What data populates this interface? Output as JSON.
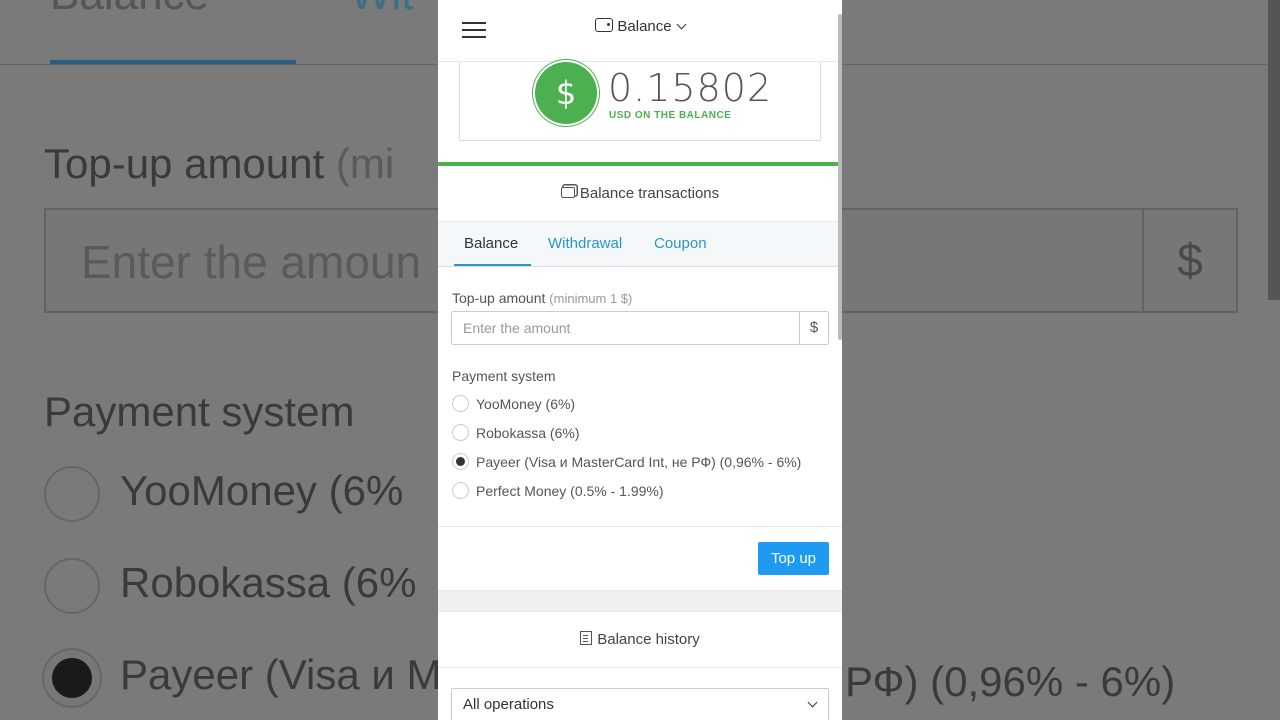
{
  "background": {
    "tab_balance": "Balance",
    "tab_withdrawal": "Wit",
    "topup_label": "Top-up amount",
    "topup_label_muted": "(mi",
    "amount_placeholder": "Enter the amoun",
    "currency_symbol": "$",
    "payment_label": "Payment system",
    "option_1": "YooMoney  (6%",
    "option_2": "Robokassa   (6%",
    "option_3": "Payeer (Visa и M",
    "option_3_tail": "РФ)  (0,96% - 6%)"
  },
  "header": {
    "title": "Balance",
    "wallet_icon": "wallet-icon",
    "menu_icon": "hamburger-icon"
  },
  "balance": {
    "amount": "0.15802",
    "unit_label": "USD ON THE BALANCE",
    "currency_symbol": "$",
    "accent_color": "#4caf50"
  },
  "transactions": {
    "title": "Balance transactions"
  },
  "tabs": [
    {
      "label": "Balance",
      "active": true
    },
    {
      "label": "Withdrawal",
      "active": false
    },
    {
      "label": "Coupon",
      "active": false
    }
  ],
  "topup_form": {
    "amount_label": "Top-up amount",
    "amount_hint": "(minimum 1 $)",
    "amount_placeholder": "Enter the amount",
    "amount_value": "",
    "currency_symbol": "$",
    "payment_label": "Payment system",
    "payment_options": [
      {
        "label": "YooMoney  (6%)",
        "selected": false
      },
      {
        "label": "Robokassa   (6%)",
        "selected": false
      },
      {
        "label": "Payeer (Visa и MasterCard Int, не РФ)  (0,96% - 6%)",
        "selected": true
      },
      {
        "label": "Perfect Money  (0.5% - 1.99%)",
        "selected": false
      }
    ],
    "submit_label": "Top up",
    "button_color": "#1e9bf0"
  },
  "history": {
    "title": "Balance history",
    "filter_value": "All operations"
  }
}
